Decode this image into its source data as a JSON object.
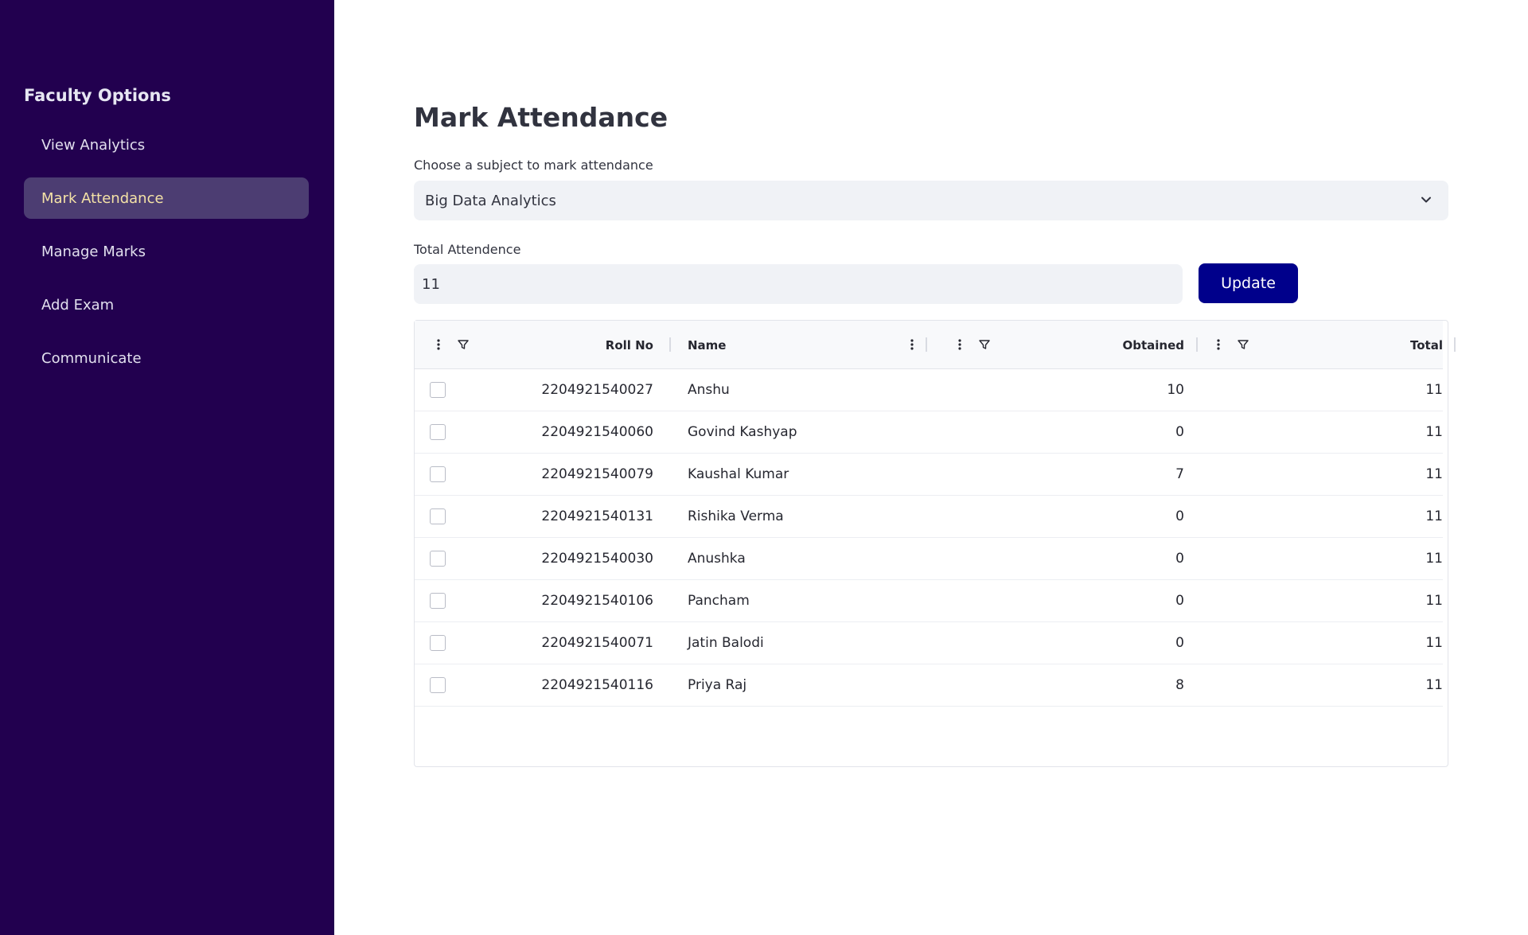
{
  "sidebar": {
    "title": "Faculty Options",
    "items": [
      {
        "label": "View Analytics",
        "active": false
      },
      {
        "label": "Mark Attendance",
        "active": true
      },
      {
        "label": "Manage Marks",
        "active": false
      },
      {
        "label": "Add Exam",
        "active": false
      },
      {
        "label": "Communicate",
        "active": false
      }
    ]
  },
  "main": {
    "title": "Mark Attendance",
    "subject_label": "Choose a subject to mark attendance",
    "subject_value": "Big Data Analytics",
    "total_label": "Total Attendence",
    "total_value": "11",
    "update_label": "Update"
  },
  "table": {
    "headers": {
      "roll": "Roll No",
      "name": "Name",
      "obtained": "Obtained",
      "total": "Total"
    },
    "rows": [
      {
        "roll": "2204921540027",
        "name": "Anshu",
        "obtained": "10",
        "total": "11"
      },
      {
        "roll": "2204921540060",
        "name": "Govind Kashyap",
        "obtained": "0",
        "total": "11"
      },
      {
        "roll": "2204921540079",
        "name": "Kaushal Kumar",
        "obtained": "7",
        "total": "11"
      },
      {
        "roll": "2204921540131",
        "name": "Rishika Verma",
        "obtained": "0",
        "total": "11"
      },
      {
        "roll": "2204921540030",
        "name": "Anushka",
        "obtained": "0",
        "total": "11"
      },
      {
        "roll": "2204921540106",
        "name": "Pancham",
        "obtained": "0",
        "total": "11"
      },
      {
        "roll": "2204921540071",
        "name": "Jatin Balodi",
        "obtained": "0",
        "total": "11"
      },
      {
        "roll": "2204921540116",
        "name": "Priya Raj",
        "obtained": "8",
        "total": "11"
      }
    ]
  },
  "colors": {
    "sidebar_bg": "#22004f",
    "active_item_bg": "#4c3d72",
    "active_item_text": "#f4e2a6",
    "button_bg": "#00008b"
  },
  "icons": {
    "column_menu": "vertical-dots-icon",
    "column_filter": "filter-icon",
    "select_caret": "chevron-down-icon"
  }
}
